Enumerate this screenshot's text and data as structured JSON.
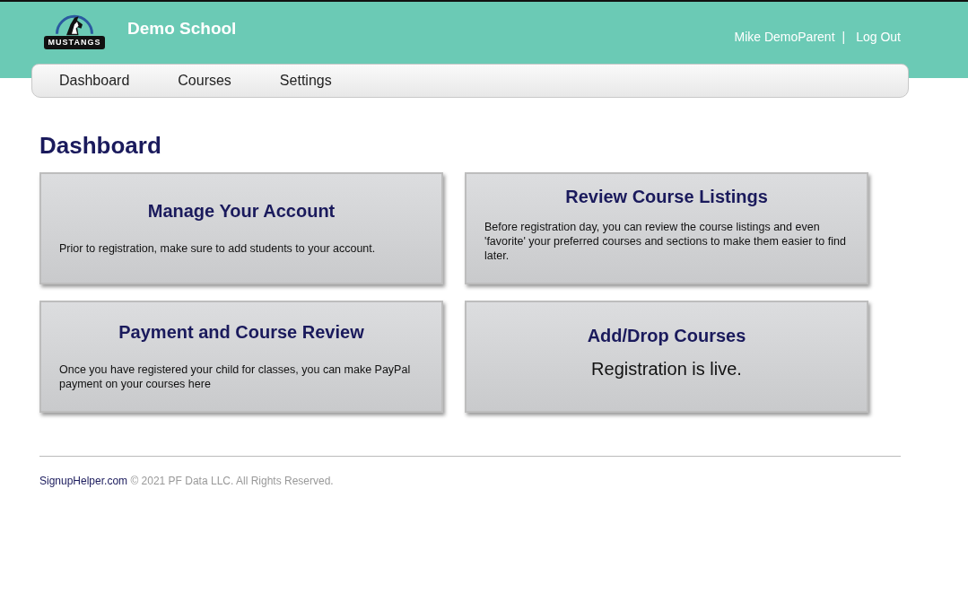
{
  "header": {
    "logo_text": "MUSTANGS",
    "school_name": "Demo School",
    "user_name": "Mike DemoParent",
    "separator": "|",
    "logout": "Log Out"
  },
  "nav": [
    {
      "label": "Dashboard"
    },
    {
      "label": "Courses"
    },
    {
      "label": "Settings"
    }
  ],
  "page_title": "Dashboard",
  "cards": [
    {
      "kind": "text",
      "title": "Manage Your Account",
      "body": "Prior to registration, make sure to add students to your account."
    },
    {
      "kind": "text",
      "title": "Review Course Listings",
      "body": "Before registration day, you can review the course listings and even 'favorite' your preferred courses and sections to make them easier to find later."
    },
    {
      "kind": "text",
      "title": "Payment and Course Review",
      "body": "Once you have registered your child for classes, you can make PayPal payment on your courses here"
    },
    {
      "kind": "status",
      "title": "Add/Drop Courses",
      "body": "Registration is live."
    }
  ],
  "footer": {
    "link": "SignupHelper.com",
    "text": "© 2021 PF Data LLC. All Rights Reserved."
  }
}
